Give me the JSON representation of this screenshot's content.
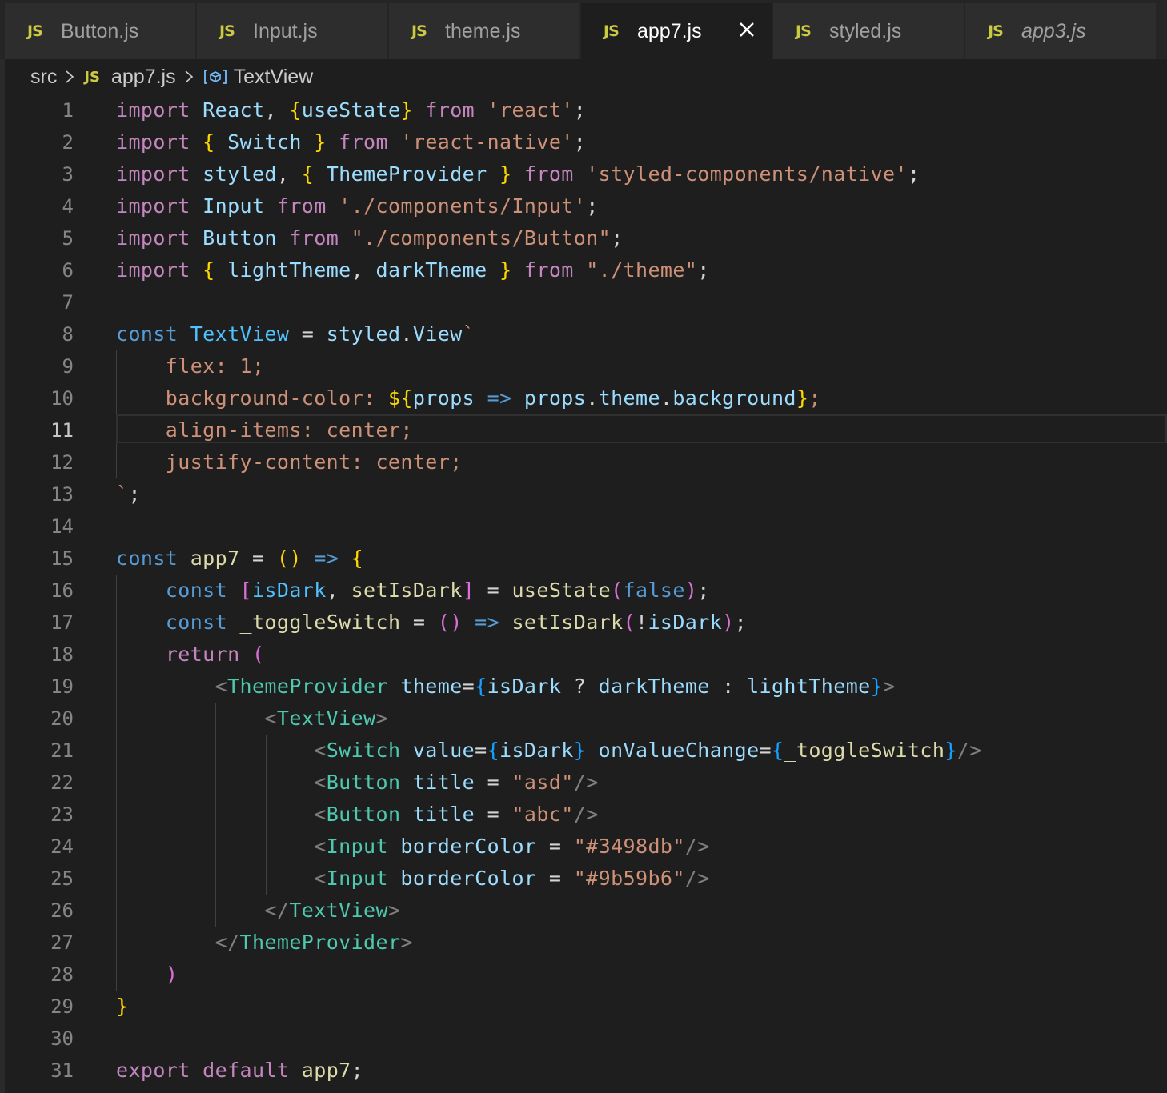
{
  "tabs": [
    {
      "icon": "JS",
      "label": "Button.js"
    },
    {
      "icon": "JS",
      "label": "Input.js"
    },
    {
      "icon": "JS",
      "label": "theme.js"
    },
    {
      "icon": "JS",
      "label": "app7.js",
      "active": true
    },
    {
      "icon": "JS",
      "label": "styled.js"
    },
    {
      "icon": "JS",
      "label": "app3.js",
      "preview": true
    }
  ],
  "breadcrumb": {
    "folder": "src",
    "file_icon": "JS",
    "file": "app7.js",
    "symbol": "TextView"
  },
  "editor": {
    "current_line": 11,
    "lines": [
      {
        "n": "1",
        "t": [
          [
            "kw",
            "import"
          ],
          [
            "pn",
            " "
          ],
          [
            "vr",
            "React"
          ],
          [
            "pn",
            ", "
          ],
          [
            "b1",
            "{"
          ],
          [
            "vr",
            "useState"
          ],
          [
            "b1",
            "}"
          ],
          [
            "pn",
            " "
          ],
          [
            "kw",
            "from"
          ],
          [
            "pn",
            " "
          ],
          [
            "st",
            "'react'"
          ],
          [
            "pn",
            ";"
          ]
        ]
      },
      {
        "n": "2",
        "t": [
          [
            "kw",
            "import"
          ],
          [
            "pn",
            " "
          ],
          [
            "b1",
            "{"
          ],
          [
            "pn",
            " "
          ],
          [
            "vr",
            "Switch"
          ],
          [
            "pn",
            " "
          ],
          [
            "b1",
            "}"
          ],
          [
            "pn",
            " "
          ],
          [
            "kw",
            "from"
          ],
          [
            "pn",
            " "
          ],
          [
            "st",
            "'react-native'"
          ],
          [
            "pn",
            ";"
          ]
        ]
      },
      {
        "n": "3",
        "t": [
          [
            "kw",
            "import"
          ],
          [
            "pn",
            " "
          ],
          [
            "vr",
            "styled"
          ],
          [
            "pn",
            ", "
          ],
          [
            "b1",
            "{"
          ],
          [
            "pn",
            " "
          ],
          [
            "vr",
            "ThemeProvider"
          ],
          [
            "pn",
            " "
          ],
          [
            "b1",
            "}"
          ],
          [
            "pn",
            " "
          ],
          [
            "kw",
            "from"
          ],
          [
            "pn",
            " "
          ],
          [
            "st",
            "'styled-components/native'"
          ],
          [
            "pn",
            ";"
          ]
        ]
      },
      {
        "n": "4",
        "t": [
          [
            "kw",
            "import"
          ],
          [
            "pn",
            " "
          ],
          [
            "vr",
            "Input"
          ],
          [
            "pn",
            " "
          ],
          [
            "kw",
            "from"
          ],
          [
            "pn",
            " "
          ],
          [
            "st",
            "'./components/Input'"
          ],
          [
            "pn",
            ";"
          ]
        ]
      },
      {
        "n": "5",
        "t": [
          [
            "kw",
            "import"
          ],
          [
            "pn",
            " "
          ],
          [
            "vr",
            "Button"
          ],
          [
            "pn",
            " "
          ],
          [
            "kw",
            "from"
          ],
          [
            "pn",
            " "
          ],
          [
            "st",
            "\"./components/Button\""
          ],
          [
            "pn",
            ";"
          ]
        ]
      },
      {
        "n": "6",
        "t": [
          [
            "kw",
            "import"
          ],
          [
            "pn",
            " "
          ],
          [
            "b1",
            "{"
          ],
          [
            "pn",
            " "
          ],
          [
            "vr",
            "lightTheme"
          ],
          [
            "pn",
            ", "
          ],
          [
            "vr",
            "darkTheme"
          ],
          [
            "pn",
            " "
          ],
          [
            "b1",
            "}"
          ],
          [
            "pn",
            " "
          ],
          [
            "kw",
            "from"
          ],
          [
            "pn",
            " "
          ],
          [
            "st",
            "\"./theme\""
          ],
          [
            "pn",
            ";"
          ]
        ]
      },
      {
        "n": "7",
        "t": []
      },
      {
        "n": "8",
        "t": [
          [
            "bl",
            "const"
          ],
          [
            "pn",
            " "
          ],
          [
            "cv",
            "TextView"
          ],
          [
            "pn",
            " = "
          ],
          [
            "vr",
            "styled"
          ],
          [
            "pn",
            "."
          ],
          [
            "vr",
            "View"
          ],
          [
            "st",
            "`"
          ]
        ]
      },
      {
        "n": "9",
        "t": [
          [
            "st",
            "    flex: 1;"
          ]
        ]
      },
      {
        "n": "10",
        "t": [
          [
            "st",
            "    background-color: "
          ],
          [
            "b1",
            "${"
          ],
          [
            "vr",
            "props"
          ],
          [
            "pn",
            " "
          ],
          [
            "bl",
            "=>"
          ],
          [
            "pn",
            " "
          ],
          [
            "vr",
            "props"
          ],
          [
            "pn",
            "."
          ],
          [
            "vr",
            "theme"
          ],
          [
            "pn",
            "."
          ],
          [
            "vr",
            "background"
          ],
          [
            "b1",
            "}"
          ],
          [
            "st",
            ";"
          ]
        ]
      },
      {
        "n": "11",
        "t": [
          [
            "st",
            "    align-items: center;"
          ]
        ]
      },
      {
        "n": "12",
        "t": [
          [
            "st",
            "    justify-content: center;"
          ]
        ]
      },
      {
        "n": "13",
        "t": [
          [
            "st",
            "`"
          ],
          [
            "pn",
            ";"
          ]
        ]
      },
      {
        "n": "14",
        "t": []
      },
      {
        "n": "15",
        "t": [
          [
            "bl",
            "const"
          ],
          [
            "pn",
            " "
          ],
          [
            "fn",
            "app7"
          ],
          [
            "pn",
            " = "
          ],
          [
            "b1",
            "()"
          ],
          [
            "pn",
            " "
          ],
          [
            "bl",
            "=>"
          ],
          [
            "pn",
            " "
          ],
          [
            "b1",
            "{"
          ]
        ]
      },
      {
        "n": "16",
        "t": [
          [
            "pn",
            "    "
          ],
          [
            "bl",
            "const"
          ],
          [
            "pn",
            " "
          ],
          [
            "b2",
            "["
          ],
          [
            "cv",
            "isDark"
          ],
          [
            "pn",
            ", "
          ],
          [
            "fn",
            "setIsDark"
          ],
          [
            "b2",
            "]"
          ],
          [
            "pn",
            " = "
          ],
          [
            "fn",
            "useState"
          ],
          [
            "b2",
            "("
          ],
          [
            "bl",
            "false"
          ],
          [
            "b2",
            ")"
          ],
          [
            "pn",
            ";"
          ]
        ]
      },
      {
        "n": "17",
        "t": [
          [
            "pn",
            "    "
          ],
          [
            "bl",
            "const"
          ],
          [
            "pn",
            " "
          ],
          [
            "fn",
            "_toggleSwitch"
          ],
          [
            "pn",
            " = "
          ],
          [
            "b2",
            "()"
          ],
          [
            "pn",
            " "
          ],
          [
            "bl",
            "=>"
          ],
          [
            "pn",
            " "
          ],
          [
            "fn",
            "setIsDark"
          ],
          [
            "b2",
            "("
          ],
          [
            "pn",
            "!"
          ],
          [
            "vr",
            "isDark"
          ],
          [
            "b2",
            ")"
          ],
          [
            "pn",
            ";"
          ]
        ]
      },
      {
        "n": "18",
        "t": [
          [
            "pn",
            "    "
          ],
          [
            "kw",
            "return"
          ],
          [
            "pn",
            " "
          ],
          [
            "b2",
            "("
          ]
        ]
      },
      {
        "n": "19",
        "t": [
          [
            "pn",
            "        "
          ],
          [
            "tg",
            "<"
          ],
          [
            "tp",
            "ThemeProvider"
          ],
          [
            "pn",
            " "
          ],
          [
            "vr",
            "theme"
          ],
          [
            "pn",
            "="
          ],
          [
            "b3",
            "{"
          ],
          [
            "vr",
            "isDark"
          ],
          [
            "pn",
            " ? "
          ],
          [
            "vr",
            "darkTheme"
          ],
          [
            "pn",
            " : "
          ],
          [
            "vr",
            "lightTheme"
          ],
          [
            "b3",
            "}"
          ],
          [
            "tg",
            ">"
          ]
        ]
      },
      {
        "n": "20",
        "t": [
          [
            "pn",
            "            "
          ],
          [
            "tg",
            "<"
          ],
          [
            "tp",
            "TextView"
          ],
          [
            "tg",
            ">"
          ]
        ]
      },
      {
        "n": "21",
        "t": [
          [
            "pn",
            "                "
          ],
          [
            "tg",
            "<"
          ],
          [
            "tp",
            "Switch"
          ],
          [
            "pn",
            " "
          ],
          [
            "vr",
            "value"
          ],
          [
            "pn",
            "="
          ],
          [
            "b3",
            "{"
          ],
          [
            "vr",
            "isDark"
          ],
          [
            "b3",
            "}"
          ],
          [
            "pn",
            " "
          ],
          [
            "vr",
            "onValueChange"
          ],
          [
            "pn",
            "="
          ],
          [
            "b3",
            "{"
          ],
          [
            "fn",
            "_toggleSwitch"
          ],
          [
            "b3",
            "}"
          ],
          [
            "tg",
            "/>"
          ]
        ]
      },
      {
        "n": "22",
        "t": [
          [
            "pn",
            "                "
          ],
          [
            "tg",
            "<"
          ],
          [
            "tp",
            "Button"
          ],
          [
            "pn",
            " "
          ],
          [
            "vr",
            "title"
          ],
          [
            "pn",
            " = "
          ],
          [
            "st",
            "\"asd\""
          ],
          [
            "tg",
            "/>"
          ]
        ]
      },
      {
        "n": "23",
        "t": [
          [
            "pn",
            "                "
          ],
          [
            "tg",
            "<"
          ],
          [
            "tp",
            "Button"
          ],
          [
            "pn",
            " "
          ],
          [
            "vr",
            "title"
          ],
          [
            "pn",
            " = "
          ],
          [
            "st",
            "\"abc\""
          ],
          [
            "tg",
            "/>"
          ]
        ]
      },
      {
        "n": "24",
        "t": [
          [
            "pn",
            "                "
          ],
          [
            "tg",
            "<"
          ],
          [
            "tp",
            "Input"
          ],
          [
            "pn",
            " "
          ],
          [
            "vr",
            "borderColor"
          ],
          [
            "pn",
            " = "
          ],
          [
            "st",
            "\"#3498db\""
          ],
          [
            "tg",
            "/>"
          ]
        ]
      },
      {
        "n": "25",
        "t": [
          [
            "pn",
            "                "
          ],
          [
            "tg",
            "<"
          ],
          [
            "tp",
            "Input"
          ],
          [
            "pn",
            " "
          ],
          [
            "vr",
            "borderColor"
          ],
          [
            "pn",
            " = "
          ],
          [
            "st",
            "\"#9b59b6\""
          ],
          [
            "tg",
            "/>"
          ]
        ]
      },
      {
        "n": "26",
        "t": [
          [
            "pn",
            "            "
          ],
          [
            "tg",
            "</"
          ],
          [
            "tp",
            "TextView"
          ],
          [
            "tg",
            ">"
          ]
        ]
      },
      {
        "n": "27",
        "t": [
          [
            "pn",
            "        "
          ],
          [
            "tg",
            "</"
          ],
          [
            "tp",
            "ThemeProvider"
          ],
          [
            "tg",
            ">"
          ]
        ]
      },
      {
        "n": "28",
        "t": [
          [
            "pn",
            "    "
          ],
          [
            "b2",
            ")"
          ]
        ]
      },
      {
        "n": "29",
        "t": [
          [
            "b1",
            "}"
          ]
        ]
      },
      {
        "n": "30",
        "t": []
      },
      {
        "n": "31",
        "t": [
          [
            "kw",
            "export"
          ],
          [
            "pn",
            " "
          ],
          [
            "kw",
            "default"
          ],
          [
            "pn",
            " "
          ],
          [
            "fn",
            "app7"
          ],
          [
            "pn",
            ";"
          ]
        ]
      }
    ]
  }
}
